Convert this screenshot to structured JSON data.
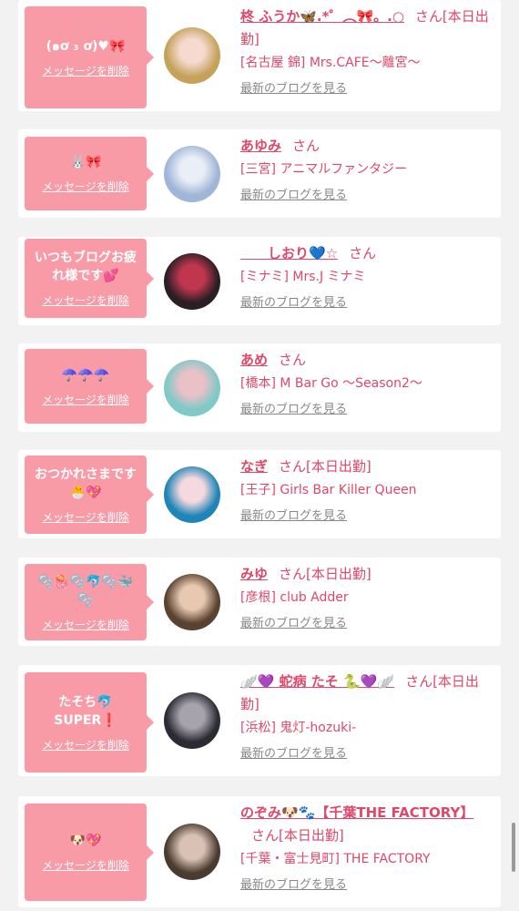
{
  "entries": [
    {
      "bubble": "(๑ơ ₃ ơ)♥🎀",
      "delete": "メッセージを削除",
      "name": "柊 ふうか🦋.*゜︵🎀。.○",
      "san": "さん[本日出勤]",
      "shop": "[名古屋 錦] Mrs.CAFE〜離宮〜",
      "blog": "最新のブログを見る",
      "avatar_colors": [
        "#c4a259",
        "#f6d9cf"
      ]
    },
    {
      "bubble": "🐰🎀",
      "delete": "メッセージを削除",
      "name": "あゆみ",
      "san": "さん",
      "shop": "[三宮] アニマルファンタジー",
      "blog": "最新のブログを見る",
      "avatar_colors": [
        "#9fb6d6",
        "#e9eef7"
      ]
    },
    {
      "bubble": "いつもブログお疲\nれ様です💕",
      "delete": "メッセージを削除",
      "name": "　　しおり💙☆",
      "san": "さん",
      "shop": "[ミナミ] Mrs.J ミナミ",
      "blog": "最新のブログを見る",
      "avatar_colors": [
        "#2a1f24",
        "#c1364f"
      ]
    },
    {
      "bubble": "☂️☂️☂️",
      "delete": "メッセージを削除",
      "name": "あめ",
      "san": "さん",
      "shop": "[橋本] M Bar Go 〜Season2〜",
      "blog": "最新のブログを見る",
      "avatar_colors": [
        "#7fc9c6",
        "#eac1c7"
      ]
    },
    {
      "bubble": "おつかれさまです\n🐣💖",
      "delete": "メッセージを削除",
      "name": "なぎ",
      "san": "さん[本日出勤]",
      "shop": "[王子] Girls Bar Killer Queen",
      "blog": "最新のブログを見る",
      "avatar_colors": [
        "#1f84b7",
        "#f4d9de"
      ]
    },
    {
      "bubble": "🫧🪼🫧🐬🫧🐳\n🫧",
      "delete": "メッセージを削除",
      "name": "みゆ",
      "san": "さん[本日出勤]",
      "shop": "[彦根] club Adder",
      "blog": "最新のブログを見る",
      "avatar_colors": [
        "#5a4231",
        "#e8c9b0"
      ]
    },
    {
      "bubble": "たそち🐬\nSUPER❗️",
      "delete": "メッセージを削除",
      "name": "🪽💜 蛇病 たそ 🐍💜🪽",
      "san": "さん[本日出勤]",
      "shop": "[浜松] 鬼灯-hozuki-",
      "blog": "最新のブログを見る",
      "avatar_colors": [
        "#2b2b33",
        "#a7a3ad"
      ]
    },
    {
      "bubble": "🐶💖",
      "delete": "メッセージを削除",
      "name": "のぞみ🐶🐾【千葉THE FACTORY】",
      "san": "さん[本日出勤]",
      "shop": "[千葉・富士見町] THE FACTORY",
      "blog": "最新のブログを見る",
      "avatar_colors": [
        "#4a3a30",
        "#d9c2b5"
      ]
    }
  ],
  "colors": {
    "accent": "#e0476a",
    "bubble": "#f99aa7",
    "blog_link": "#888888",
    "background": "#f2f2f2"
  }
}
